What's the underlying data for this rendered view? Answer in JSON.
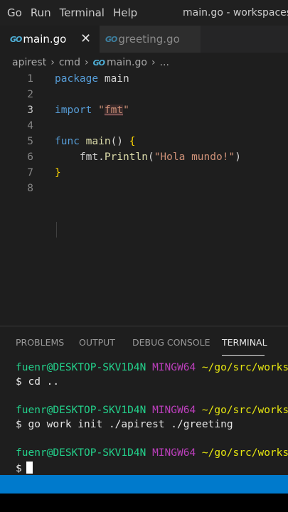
{
  "menubar": {
    "items": [
      "Go",
      "Run",
      "Terminal",
      "Help"
    ],
    "window_title": "main.go - workspaces - \\"
  },
  "tabs": [
    {
      "label": "main.go",
      "active": true,
      "icon": "go-file-icon",
      "icon_text": "GO"
    },
    {
      "label": "greeting.go",
      "active": false,
      "icon": "go-file-icon",
      "icon_text": "GO"
    }
  ],
  "close_glyph": "✕",
  "breadcrumb": [
    "apirest",
    "cmd",
    "main.go",
    "..."
  ],
  "editor": {
    "line_numbers": [
      "1",
      "2",
      "3",
      "4",
      "5",
      "6",
      "7",
      "8"
    ],
    "current_line": "3",
    "code": {
      "l1_kw": "package",
      "l1_name": " main",
      "l3_kw": "import",
      "l3_q1": " \"",
      "l3_pkg": "fmt",
      "l3_q2": "\"",
      "l5_kw": "func",
      "l5_fn": " main",
      "l5_paren": "() ",
      "l5_brace": "{",
      "l6_pkg": "fmt",
      "l6_dot": ".",
      "l6_fn": "Println",
      "l6_open": "(",
      "l6_str": "\"Hola mundo!\"",
      "l6_close": ")",
      "l7_brace": "}"
    }
  },
  "panel": {
    "tabs": [
      "PROBLEMS",
      "OUTPUT",
      "DEBUG CONSOLE",
      "TERMINAL"
    ],
    "active_tab": "TERMINAL"
  },
  "terminal": {
    "user": "fuenr@DESKTOP-SKV1D4N",
    "mingw": "MINGW64",
    "path": "~/go/src/worksp",
    "prompt": "$",
    "commands": [
      "cd ..",
      "go work init ./apirest ./greeting",
      ""
    ]
  },
  "colors": {
    "statusbar": "#007acc",
    "editor_bg": "#1e1e1e",
    "keyword": "#569cd6",
    "string": "#ce9178"
  }
}
